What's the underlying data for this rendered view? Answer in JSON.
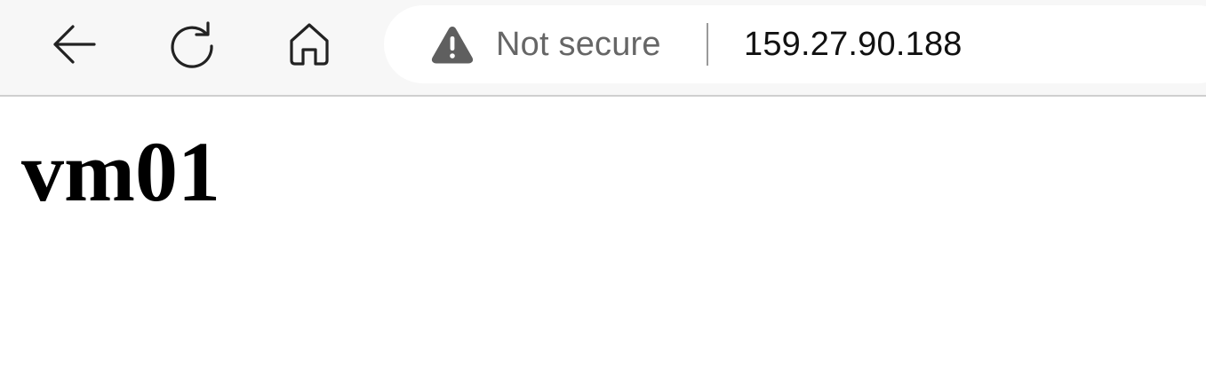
{
  "browser": {
    "nav": {
      "back_icon": "arrow-left-icon",
      "reload_icon": "reload-icon",
      "home_icon": "home-icon"
    },
    "address_bar": {
      "security_icon": "warning-triangle-icon",
      "security_label": "Not secure",
      "url": "159.27.90.188"
    }
  },
  "page": {
    "heading": "vm01"
  },
  "colors": {
    "toolbar_bg": "#f7f7f7",
    "address_bar_bg": "#ffffff",
    "security_text": "#666666",
    "url_text": "#111111",
    "icon_stroke": "#222222",
    "warning_fill": "#5f5f5f"
  }
}
